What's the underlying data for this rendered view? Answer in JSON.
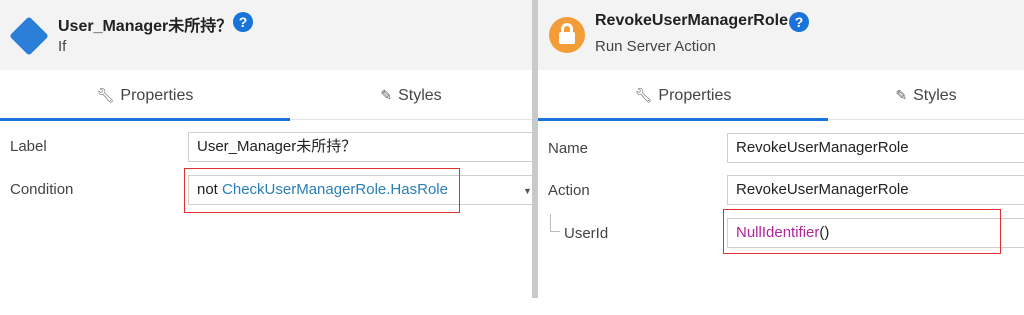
{
  "left_panel": {
    "title": "User_Manager未所持？",
    "subtitle": "If",
    "help": "?",
    "tabs": [
      {
        "label": "Properties",
        "icon": "wrench-icon",
        "active": true
      },
      {
        "label": "Styles",
        "icon": "brush-icon",
        "active": false
      }
    ],
    "label_row": {
      "label": "Label",
      "value": "User_Manager未所持？"
    },
    "condition_row": {
      "label": "Condition",
      "keyword": "not ",
      "reference": "CheckUserManagerRole.HasRole",
      "arrow": "▼"
    }
  },
  "right_panel": {
    "title": "RevokeUserManagerRole",
    "subtitle": "Run Server Action",
    "help": "?",
    "tabs": [
      {
        "label": "Properties",
        "icon": "wrench-icon",
        "active": true
      },
      {
        "label": "Styles",
        "icon": "brush-icon",
        "active": false
      }
    ],
    "name_row": {
      "label": "Name",
      "value": "RevokeUserManagerRole"
    },
    "action_row": {
      "label": "Action",
      "value": "RevokeUserManagerRole"
    },
    "userid_row": {
      "label": "UserId",
      "function": "NullIdentifier",
      "suffix": "()"
    }
  },
  "colors": {
    "accent": "#1a73d9",
    "diamond": "#2b7fd9",
    "lock": "#f29d38",
    "highlight": "#e0302f",
    "reference_text": "#2a7fb5",
    "function_text": "#b1269b"
  }
}
